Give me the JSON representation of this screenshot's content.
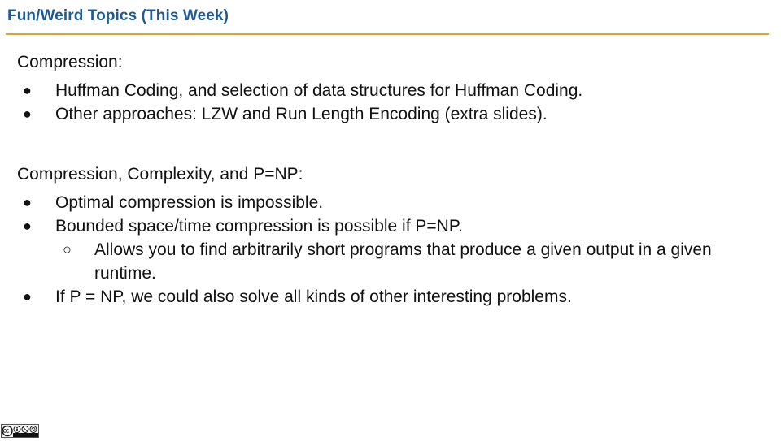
{
  "slide": {
    "title": "Fun/Weird Topics (This Week)",
    "accent_color": "#d9a531",
    "title_color": "#1f5a92"
  },
  "section1": {
    "heading": "Compression:",
    "bullets": [
      "Huffman Coding, and selection of data structures for Huffman Coding.",
      "Other approaches: LZW and Run Length Encoding (extra slides)."
    ]
  },
  "section2": {
    "heading": "Compression, Complexity, and P=NP:",
    "bullets": [
      "Optimal compression is impossible.",
      "Bounded space/time compression is possible if P=NP.",
      "If P = NP, we could also solve all kinds of other interesting problems."
    ],
    "sub_bullets": [
      "Allows you to find arbitrarily short programs that produce a given output in a given runtime."
    ]
  },
  "glyphs": {
    "bullet": "●",
    "sub_bullet": "○"
  },
  "footer": {
    "license_icon": "creative-commons-by-nc-sa-icon"
  }
}
